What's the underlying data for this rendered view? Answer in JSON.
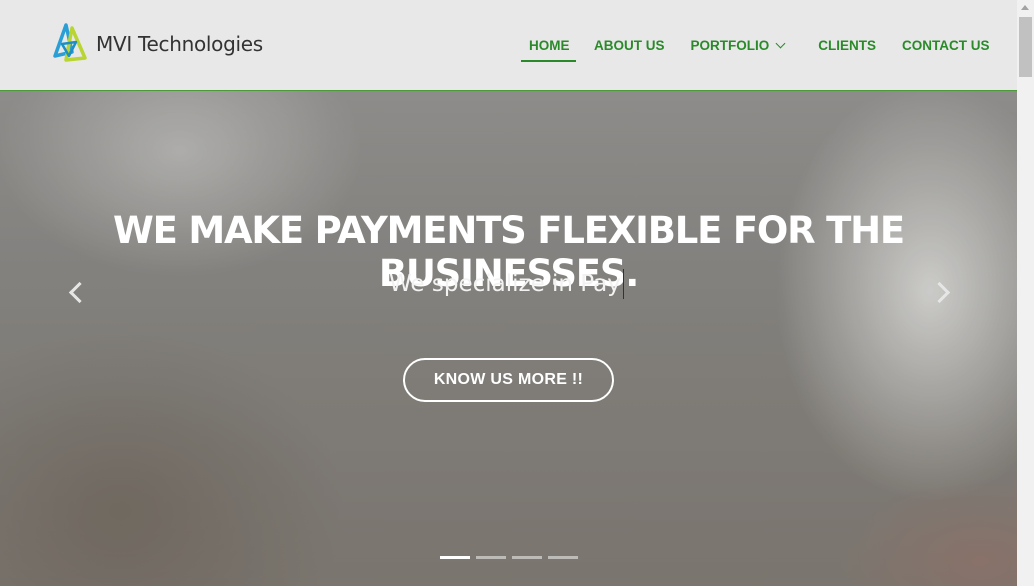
{
  "header": {
    "brand_name": "MVI Technologies",
    "logo_icon": "mvi-triangle-logo",
    "nav": [
      {
        "label": "HOME",
        "active": true
      },
      {
        "label": "ABOUT US",
        "active": false
      },
      {
        "label": "PORTFOLIO",
        "active": false,
        "has_dropdown": true
      },
      {
        "label": "CLIENTS",
        "active": false
      },
      {
        "label": "CONTACT US",
        "active": false
      }
    ]
  },
  "hero": {
    "headline": "WE MAKE PAYMENTS FLEXIBLE FOR THE BUSINESSES.",
    "typed_text": "We specialize in Pay",
    "cta_label": "KNOW US MORE !!",
    "prev_icon": "chevron-left-icon",
    "next_icon": "chevron-right-icon",
    "slide_count": 4,
    "active_slide": 1
  },
  "colors": {
    "accent_green": "#2a8a2a",
    "header_bg": "#e8e8e8",
    "white": "#ffffff"
  }
}
